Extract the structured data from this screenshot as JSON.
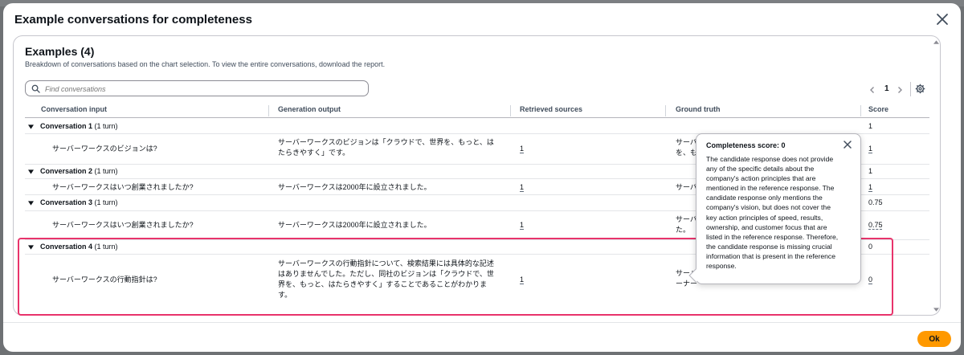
{
  "modal": {
    "title": "Example conversations for completeness",
    "ok_label": "Ok"
  },
  "examples": {
    "title": "Examples (4)",
    "description": "Breakdown of conversations based on the chart selection. To view the entire conversations, download the report.",
    "search_placeholder": "Find conversations",
    "current_page": "1"
  },
  "columns": [
    "Conversation input",
    "Generation output",
    "Retrieved sources",
    "Ground truth",
    "Score"
  ],
  "groups": [
    {
      "label": "Conversation 1",
      "turns": "(1 turn)",
      "score": "1",
      "row": {
        "input": "サーバーワークスのビジョンは?",
        "output": [
          "サーバーワークスのビジョンは「クラウドで、世界を、もっと、は",
          "たらきやすく」です。"
        ],
        "sources": "1",
        "truth": [
          "サーバ",
          "を、も"
        ],
        "score": "1"
      }
    },
    {
      "label": "Conversation 2",
      "turns": "(1 turn)",
      "score": "1",
      "row": {
        "input": "サーバーワークスはいつ創業されましたか?",
        "output": [
          "サーバーワークスは2000年に設立されました。"
        ],
        "sources": "1",
        "truth": [
          "サーバ"
        ],
        "score": "1"
      }
    },
    {
      "label": "Conversation 3",
      "turns": "(1 turn)",
      "score": "0.75",
      "row": {
        "input": "サーバーワークスはいつ創業されましたか?",
        "output": [
          "サーバーワークスは2000年に設立されました。"
        ],
        "sources": "1",
        "truth": [
          "サーバ",
          "た。"
        ],
        "score": "0.75"
      }
    },
    {
      "label": "Conversation 4",
      "turns": "(1 turn)",
      "score": "0",
      "row": {
        "input": "サーバーワークスの行動指針は?",
        "output": [
          "サーバーワークスの行動指針について、検索結果には具体的な記述",
          "はありませんでした。ただし、同社のビジョンは「クラウドで、世",
          "界を、もっと、はたらきやすく」することであることがわかりま",
          "す。"
        ],
        "sources": "1",
        "truth": [
          "サーバ",
          "ーナー"
        ],
        "score": "0"
      }
    }
  ],
  "popover": {
    "title": "Completeness score: 0",
    "lines": [
      "The candidate response does not provide",
      "any of the specific details about the",
      "company's action principles that are",
      "mentioned in the reference response. The",
      "candidate response only mentions the",
      "company's vision, but does not cover the",
      "key action principles of speed, results,",
      "ownership, and customer focus that are",
      "listed in the reference response. Therefore,",
      "the candidate response is missing crucial",
      "information that is present in the reference",
      "response."
    ]
  },
  "icons": {
    "close": "close-icon",
    "search": "search-icon",
    "settings": "gear-icon",
    "prev": "chevron-left-icon",
    "next": "chevron-right-icon",
    "expand": "caret-down-icon"
  },
  "colors": {
    "primary_button": "#ff9900",
    "highlight": "#e8336b",
    "text": "#0f141a"
  }
}
